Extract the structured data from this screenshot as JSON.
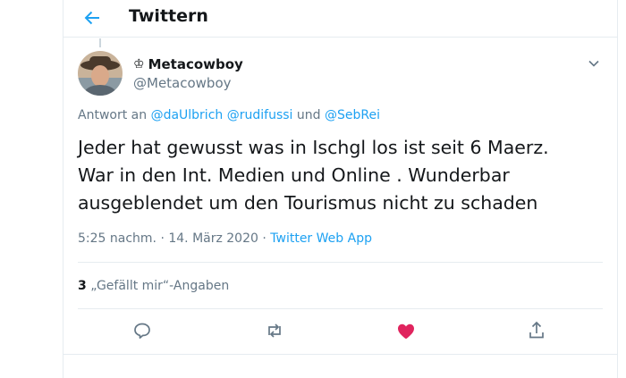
{
  "header": {
    "title": "Twittern"
  },
  "tweet": {
    "crown": "♔",
    "display_name": "Metacowboy",
    "handle": "@Metacowboy",
    "reply_prefix": "Antwort an ",
    "reply_user1": "@daUlbrich",
    "reply_user2": "@rudifussi",
    "reply_and": " und ",
    "reply_user3": "@SebRei",
    "text": "Jeder hat gewusst was in Ischgl los ist seit 6 Maerz.\nWar in den Int. Medien und Online . Wunderbar\nausgeblendet um den Tourismus nicht zu schaden",
    "time": "5:25 nachm. · 14. März 2020",
    "dot": " · ",
    "source": "Twitter Web App",
    "like_count": "3",
    "like_label": " „Gefällt mir“-Angaben"
  },
  "icons": {
    "back": "arrow-left-icon",
    "caret": "chevron-down-icon",
    "reply": "reply-icon",
    "retweet": "retweet-icon",
    "like": "heart-icon",
    "share": "share-icon"
  },
  "colors": {
    "accent": "#1da1f2",
    "like": "#e0245e",
    "muted": "#657786",
    "border": "#e6ecf0"
  }
}
